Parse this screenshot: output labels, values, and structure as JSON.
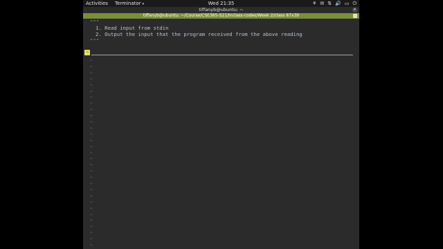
{
  "topbar": {
    "activities": "Activities",
    "app_menu": "Terminator",
    "clock": "Wed 21:35",
    "tray_icons": [
      "accessibility-icon",
      "keyboard-layout-icon",
      "network-icon",
      "volume-icon",
      "battery-icon",
      "power-icon"
    ],
    "tray_glyphs": [
      "⚘",
      "✉",
      "⇅",
      "🔊",
      "▭",
      "⏻"
    ]
  },
  "window": {
    "title": "tiffanyb@ubuntu: ~",
    "close_glyph": "✕"
  },
  "terminal": {
    "title": "tiffanyb@ubuntu: ~/Course/CSE365-S21/Inclass-codes/Week 2/class 87x39",
    "lines": {
      "open_quote": "\"\"\"",
      "item1": "1. Read input from stdin",
      "item2": "2. Output the input that the program received from the above reading",
      "close_quote": "\"\"\""
    },
    "cursor_char": "~",
    "tilde_char": "~"
  },
  "colors": {
    "tab_strip": "#7a8f3a",
    "cursor": "#e8e25c",
    "text": "#b8c6d8",
    "background": "#2b2b2b"
  }
}
